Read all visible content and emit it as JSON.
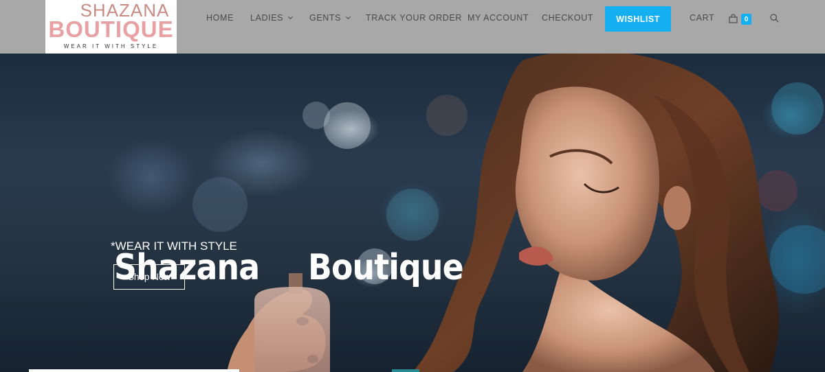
{
  "brand": {
    "line1": "SHAZANA",
    "line2": "BOUTIQUE",
    "tagline": "WEAR IT WITH STYLE"
  },
  "nav": {
    "items": [
      {
        "label": "HOME"
      },
      {
        "label": "LADIES"
      },
      {
        "label": "GENTS"
      },
      {
        "label": "TRACK YOUR ORDER"
      },
      {
        "label": "MY ACCOUNT"
      },
      {
        "label": "CHECKOUT"
      }
    ],
    "wishlist": "WISHLIST",
    "cart": "CART",
    "cart_count": "0",
    "icons": [
      "chevron-down-icon",
      "shopping-bag-icon",
      "search-icon"
    ]
  },
  "hero": {
    "title_word1": "Shazana",
    "title_word2": "Boutique",
    "subtitle": "*WEAR IT WITH STYLE",
    "cta": "Shop Now"
  },
  "colors": {
    "header_bg": "#a8a8a8",
    "accent": "#13aff0",
    "logo_pink": "#e8a0a2",
    "nav_text": "#4a4a4a",
    "hero_text": "#ffffff"
  }
}
